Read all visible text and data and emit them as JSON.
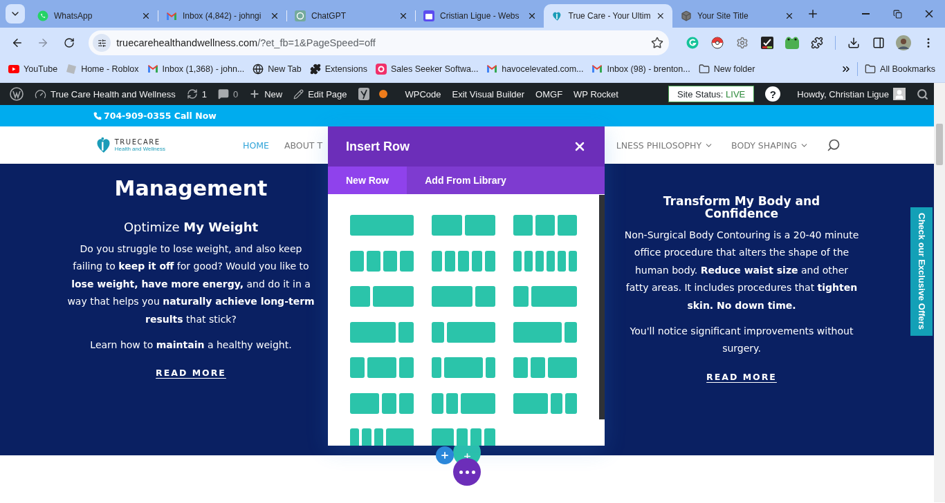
{
  "browser": {
    "tabs": [
      {
        "kind": "whatsapp",
        "title": "WhatsApp",
        "selected": false
      },
      {
        "kind": "gmail",
        "title": "Inbox (4,842) - johngi",
        "selected": false
      },
      {
        "kind": "chatgpt",
        "title": "ChatGPT",
        "selected": false
      },
      {
        "kind": "calendar",
        "title": "Cristian Ligue - Webs",
        "selected": false
      },
      {
        "kind": "truecare",
        "title": "True Care - Your Ultim",
        "selected": true
      },
      {
        "kind": "cube",
        "title": "Your Site Title",
        "selected": false
      }
    ],
    "address": {
      "host": "truecarehealthandwellness.com",
      "path": "/?et_fb=1&PageSpeed=off"
    },
    "bookmarks": [
      {
        "kind": "youtube",
        "label": "YouTube"
      },
      {
        "kind": "roblox",
        "label": "Home - Roblox"
      },
      {
        "kind": "gmail",
        "label": "Inbox (1,368) - john..."
      },
      {
        "kind": "globe",
        "label": "New Tab"
      },
      {
        "kind": "puzzle",
        "label": "Extensions"
      },
      {
        "kind": "sales",
        "label": "Sales Seeker Softwa..."
      },
      {
        "kind": "gmail",
        "label": "havocelevated.com..."
      },
      {
        "kind": "gmail",
        "label": "Inbox (98) - brenton..."
      },
      {
        "kind": "folder",
        "label": "New folder"
      }
    ],
    "all_bookmarks": "All Bookmarks"
  },
  "admin_bar": {
    "site_name": "True Care Health and Wellness",
    "updates": "1",
    "comments": "0",
    "new": "New",
    "edit": "Edit Page",
    "items": [
      "WPCode",
      "Exit Visual Builder",
      "OMGF",
      "WP Rocket"
    ],
    "site_status": {
      "label": "Site Status:",
      "value": "LIVE"
    },
    "help": "?",
    "howdy": "Howdy, Christian Ligue"
  },
  "top_strip": {
    "phone": "704-909-0355 Call Now"
  },
  "header": {
    "logo": {
      "name": "TRUECARE",
      "tagline": "Health and Wellness"
    },
    "nav": [
      {
        "label": "HOME",
        "selected": true,
        "dropdown": false
      },
      {
        "label": "ABOUT T",
        "selected": false,
        "dropdown": false
      },
      {
        "label": "LNESS PHILOSOPHY",
        "selected": false,
        "dropdown": true
      },
      {
        "label": "BODY SHAPING",
        "selected": false,
        "dropdown": true
      }
    ]
  },
  "sections": [
    {
      "heading_lines": [
        "Management"
      ],
      "subtitle": "Optimize **My Weight**",
      "paragraphs": [
        "Do you struggle to lose weight, and also keep failing to **keep it off** for good? Would you like to **lose weight, have more energy,** and do it in a way that helps you **naturally achieve long-term results** that stick?",
        "Learn how to **maintain** a healthy weight."
      ],
      "link": "READ MORE"
    },
    {
      "subtitle": "**Transform My Body and Confidence**",
      "paragraphs": [
        "Non-Surgical Body Contouring is a 20-40 minute office procedure that alters the shape of the human body.  **Reduce waist size** and other fatty areas.  It includes procedures that **tighten skin.  No down time.**",
        "You'll notice significant improvements without surgery."
      ],
      "link": "READ MORE"
    }
  ],
  "offers_tab": "Check our Exclusive Offers",
  "modal": {
    "title": "Insert Row",
    "tabs": [
      {
        "label": "New Row",
        "selected": true
      },
      {
        "label": "Add From Library",
        "selected": false
      }
    ]
  }
}
